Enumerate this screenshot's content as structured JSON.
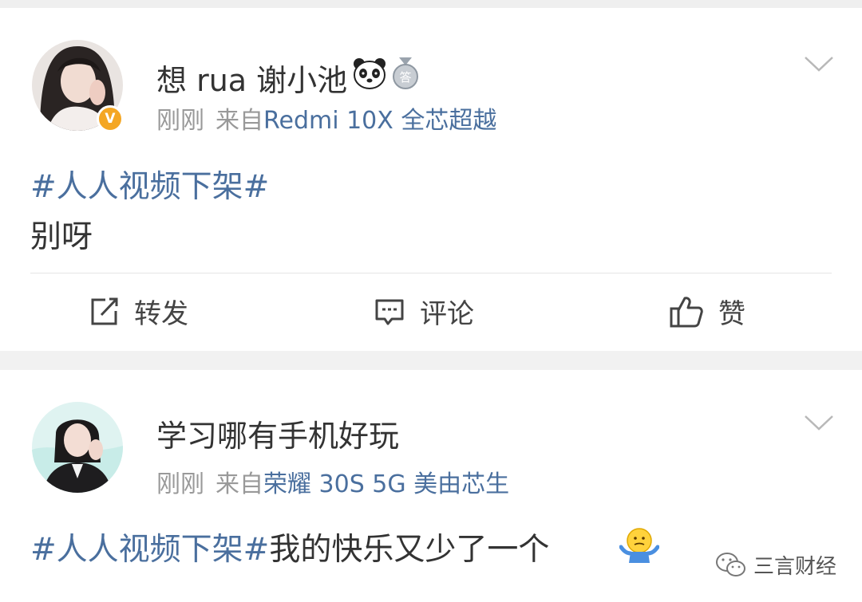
{
  "posts": [
    {
      "username": "想 rua 谢小池",
      "time": "刚刚",
      "from_prefix": "来自",
      "device": "Redmi 10X 全芯超越",
      "topic": "#人人视频下架#",
      "text": "别呀",
      "verified_badge": "V",
      "badge_icons": [
        "panda-icon",
        "medal-icon"
      ],
      "medal_text": "答"
    },
    {
      "username": "学习哪有手机好玩",
      "time": "刚刚",
      "from_prefix": "来自",
      "device": "荣耀 30S 5G 美由芯生",
      "topic": "#人人视频下架#",
      "text": "我的快乐又少了一个",
      "emoji_icon": "shrug-emoji-icon"
    }
  ],
  "actions": [
    {
      "icon": "repost-icon",
      "label": "转发"
    },
    {
      "icon": "comment-icon",
      "label": "评论"
    },
    {
      "icon": "like-thumb-icon",
      "label": "赞"
    }
  ],
  "watermark": {
    "icon": "wechat-icon",
    "text": "三言财经"
  },
  "colors": {
    "link": "#4a6f9e",
    "meta_gray": "#999999",
    "background": "#f1f1f1",
    "verified": "#f4a623"
  }
}
